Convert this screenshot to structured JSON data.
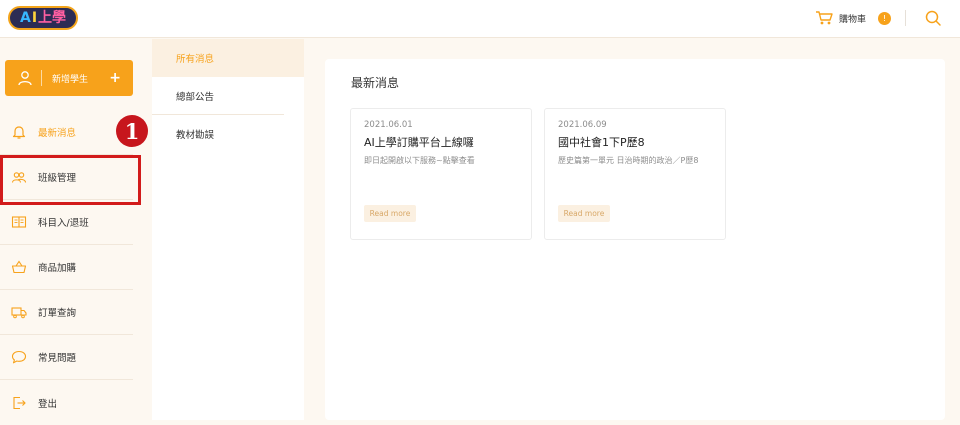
{
  "header": {
    "logo_text": [
      "A",
      "I",
      "上學"
    ],
    "cart_label": "購物車",
    "cart_count": "!"
  },
  "sidebar": {
    "add_student_label": "新增學生",
    "items": [
      {
        "label": "最新消息",
        "icon": "bell-icon",
        "active": true
      },
      {
        "label": "班級管理",
        "icon": "users-icon",
        "active": false
      },
      {
        "label": "科目入/退班",
        "icon": "book-icon",
        "active": false
      },
      {
        "label": "商品加購",
        "icon": "basket-icon",
        "active": false
      },
      {
        "label": "訂單查詢",
        "icon": "truck-icon",
        "active": false
      },
      {
        "label": "常見問題",
        "icon": "chat-icon",
        "active": false
      },
      {
        "label": "登出",
        "icon": "logout-icon",
        "active": false
      }
    ],
    "step_number": "1"
  },
  "subnav": {
    "items": [
      {
        "label": "所有消息",
        "active": true
      },
      {
        "label": "總部公告",
        "active": false
      },
      {
        "label": "教材勘誤",
        "active": false
      }
    ]
  },
  "main": {
    "title": "最新消息",
    "cards": [
      {
        "date": "2021.06.01",
        "title": "AI上學訂購平台上線囉",
        "desc": "即日起開啟以下服務~點擊查看",
        "more": "Read more"
      },
      {
        "date": "2021.06.09",
        "title": "國中社會1下P歷8",
        "desc": "歷史篇第一單元 日治時期的政治／P歷8",
        "more": "Read more"
      }
    ]
  },
  "colors": {
    "accent": "#f7a21b",
    "highlight": "#d21b1b",
    "background": "#fdf8f1"
  }
}
